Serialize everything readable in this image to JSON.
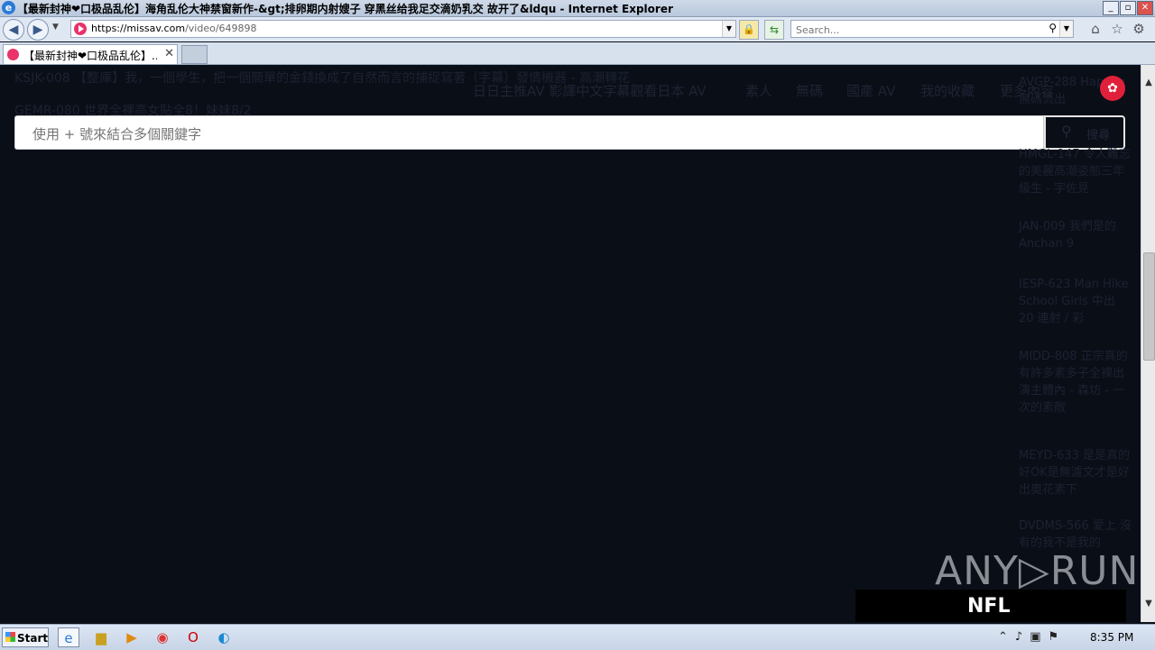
{
  "window": {
    "title": "【最新封神❤口极品乱伦】海角乱伦大神禁窗新作-&gt;排卵期内射嫂子 穿黑丝给我足交滴奶乳交 故开了&ldqu - Internet Explorer",
    "controls": {
      "minimize": "_",
      "maximize": "▫",
      "close": "✕"
    }
  },
  "addressbar": {
    "url_host": "https://missav.com",
    "url_path": "/video/649898",
    "search_placeholder": "Search..."
  },
  "tabs": [
    {
      "label": "【最新封神❤口极品乱伦】..."
    }
  ],
  "page": {
    "bg_items": [
      "KSJK-008 【整庫】我，一個學生，把一個簡單的金錢換成了自然而言的捕捉寫著（字幕）發情機器 - 高潮轉花",
      "GEMR-080 世界全裸高女貼全8！妹妹8/2"
    ],
    "nav_header": "日日主推AV 影譯中文字幕觀看日本 AV",
    "nav": [
      "素人",
      "無碼",
      "國產 AV",
      "我的收藏",
      "更多內容"
    ],
    "search": {
      "placeholder": "使用 + 號來結合多個關鍵字",
      "button_label": "搜尋"
    },
    "sidebar": [
      "AVGP-288 Happiin 無碼流出",
      "HMGL-147 令人難忘的美麗高潮姿態三年級生 - 宇佐見",
      "JAN-009 我們是的 Anchan 9",
      "IESP-623 Man Hike School Girls 中出 20 連射 / 彩",
      "MIDD-808 正宗真的有許多素多子全裸出演主體內 - 森坊 - 一次的素敵",
      "MEYD-633 是是真的好OK是無濾文才是好出奧花素下",
      "DVDMS-566 愛上 沒有的我不是我的"
    ]
  },
  "watermark": {
    "brand": "ANY▷RUN",
    "sub": "NFL"
  },
  "taskbar": {
    "start_label": "Start",
    "clock": "8:35 PM",
    "apps": [
      "ie-icon",
      "folder-icon",
      "media-player-icon",
      "chrome-icon",
      "opera-icon",
      "edge-icon"
    ]
  }
}
